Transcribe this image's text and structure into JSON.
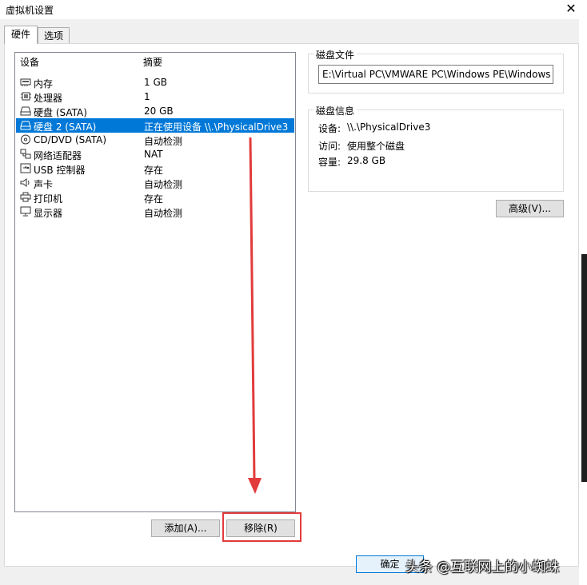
{
  "window": {
    "title": "虚拟机设置"
  },
  "tabs": [
    {
      "label": "硬件"
    },
    {
      "label": "选项"
    }
  ],
  "device_list": {
    "columns": {
      "device": "设备",
      "summary": "摘要"
    },
    "rows": [
      {
        "icon": "memory-icon",
        "name": "内存",
        "summary": "1 GB"
      },
      {
        "icon": "processor-icon",
        "name": "处理器",
        "summary": "1"
      },
      {
        "icon": "hard-disk-icon",
        "name": "硬盘 (SATA)",
        "summary": "20 GB"
      },
      {
        "icon": "hard-disk-icon",
        "name": "硬盘 2 (SATA)",
        "summary": "正在使用设备 \\\\.\\PhysicalDrive3"
      },
      {
        "icon": "cd-dvd-icon",
        "name": "CD/DVD (SATA)",
        "summary": "自动检测"
      },
      {
        "icon": "network-adapter-icon",
        "name": "网络适配器",
        "summary": "NAT"
      },
      {
        "icon": "usb-icon",
        "name": "USB 控制器",
        "summary": "存在"
      },
      {
        "icon": "sound-card-icon",
        "name": "声卡",
        "summary": "自动检测"
      },
      {
        "icon": "printer-icon",
        "name": "打印机",
        "summary": "存在"
      },
      {
        "icon": "display-icon",
        "name": "显示器",
        "summary": "自动检测"
      }
    ],
    "selected_index": 3
  },
  "buttons": {
    "add": "添加(A)...",
    "remove": "移除(R)",
    "advanced": "高级(V)...",
    "ok": "确定"
  },
  "disk_file": {
    "group_label": "磁盘文件",
    "path": "E:\\Virtual PC\\VMWARE PC\\Windows PE\\Windows PE"
  },
  "disk_info": {
    "group_label": "磁盘信息",
    "device_label": "设备:",
    "device_value": "\\\\.\\PhysicalDrive3",
    "access_label": "访问:",
    "access_value": "使用整个磁盘",
    "capacity_label": "容量:",
    "capacity_value": "29.8 GB"
  },
  "watermark": "头条 @互联网上的小蜘蛛",
  "colors": {
    "selection": "#0078d7",
    "annotation_red": "#e23b3b"
  }
}
